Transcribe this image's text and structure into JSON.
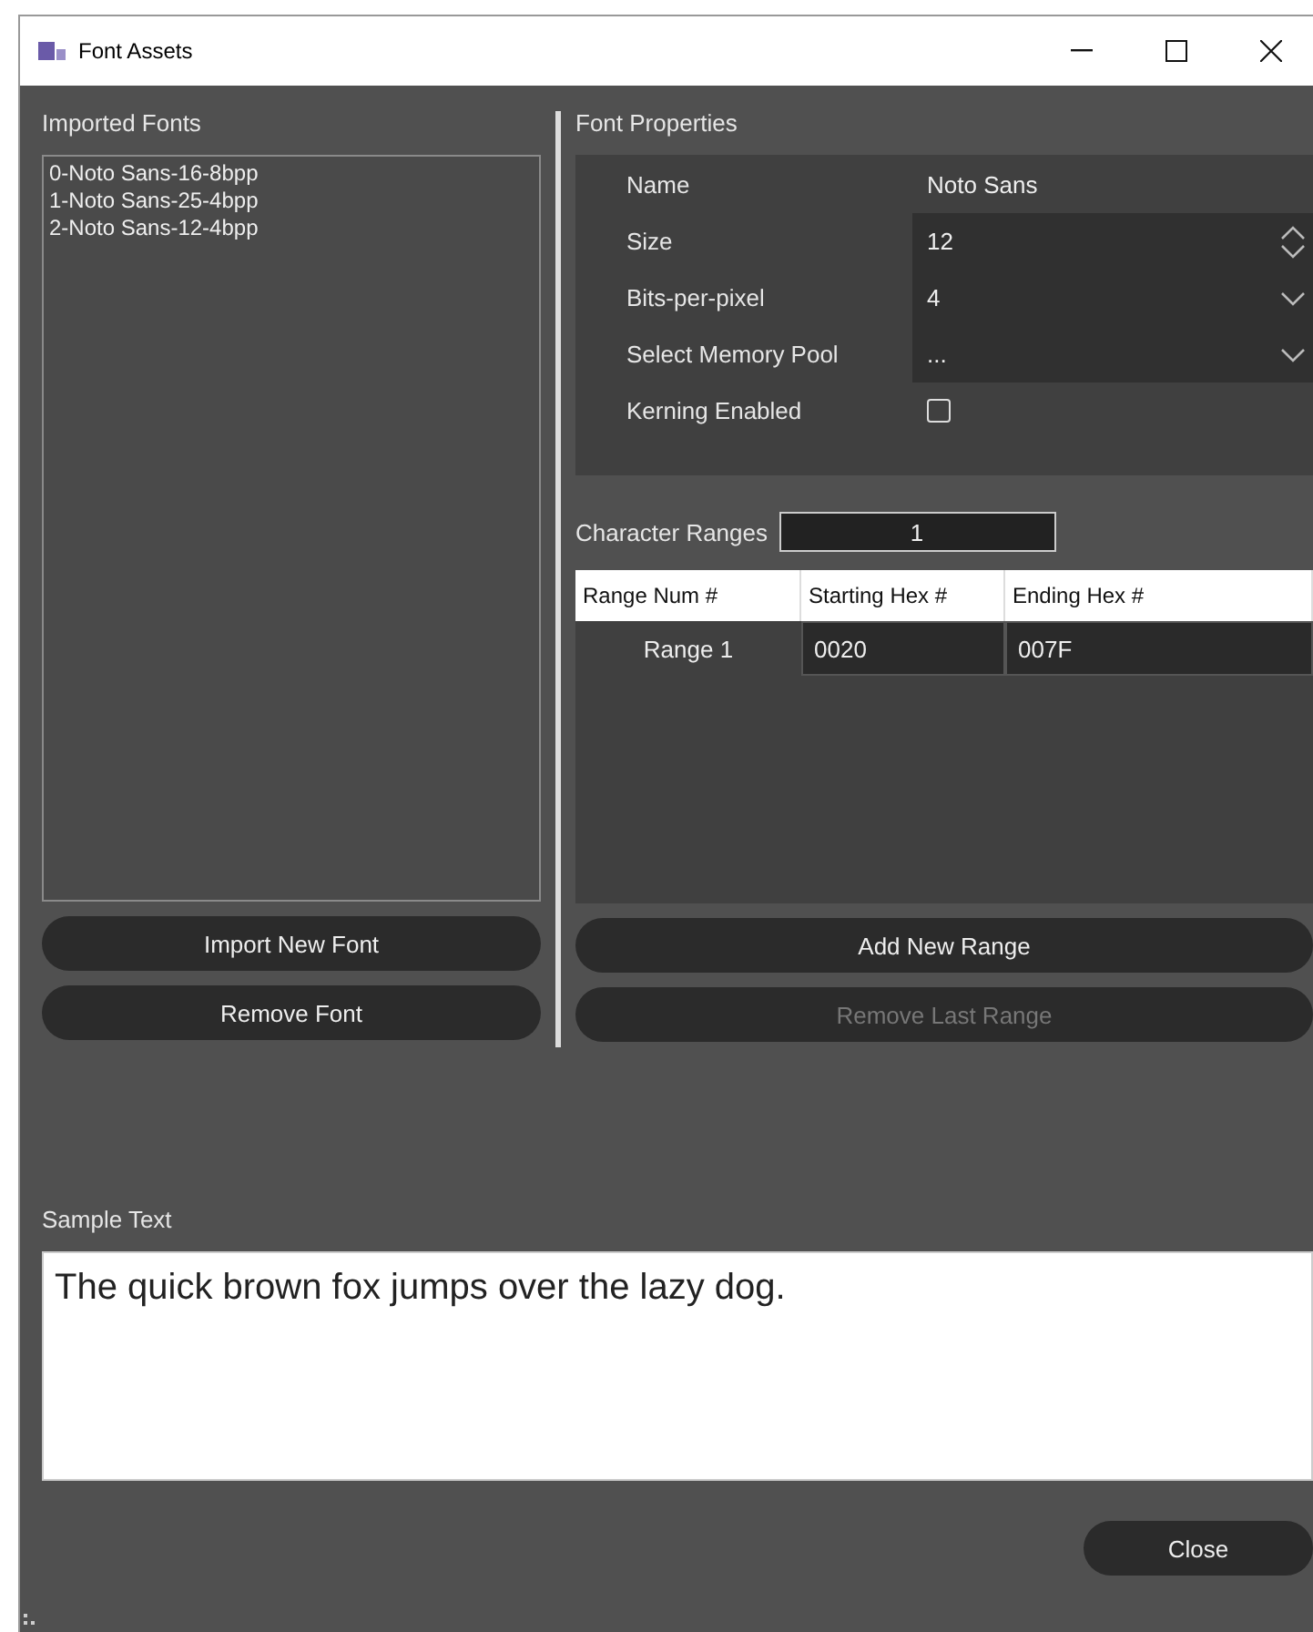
{
  "window": {
    "title": "Font Assets"
  },
  "imported_fonts": {
    "label": "Imported Fonts",
    "items": [
      {
        "label": "0-Noto Sans-16-8bpp",
        "selected": false
      },
      {
        "label": "1-Noto Sans-25-4bpp",
        "selected": false
      },
      {
        "label": "2-Noto Sans-12-4bpp",
        "selected": false
      }
    ],
    "buttons": [
      {
        "label": "Import New Font",
        "disabled": false
      },
      {
        "label": "Remove Font",
        "disabled": false
      }
    ]
  },
  "font_properties": {
    "label": "Font Properties",
    "rows": [
      {
        "kind": "text",
        "label": "Name",
        "value": "Noto Sans"
      },
      {
        "kind": "spinner",
        "label": "Size",
        "value": "12"
      },
      {
        "kind": "dropdown",
        "label": "Bits-per-pixel",
        "value": "4"
      },
      {
        "kind": "dropdown",
        "label": "Select Memory Pool",
        "value": "..."
      },
      {
        "kind": "checkbox",
        "label": "Kerning Enabled",
        "checked": false
      }
    ]
  },
  "character_ranges": {
    "label": "Character Ranges",
    "count": "1",
    "columns": [
      "Range Num #",
      "Starting Hex #",
      "Ending Hex #"
    ],
    "rows": [
      [
        "Range 1",
        "0020",
        "007F"
      ]
    ],
    "buttons": [
      {
        "label": "Add New Range",
        "disabled": false
      },
      {
        "label": "Remove Last Range",
        "disabled": true
      }
    ]
  },
  "sample_text": {
    "label": "Sample Text",
    "value": "The quick brown fox jumps over the lazy dog."
  },
  "close_button": "Close"
}
